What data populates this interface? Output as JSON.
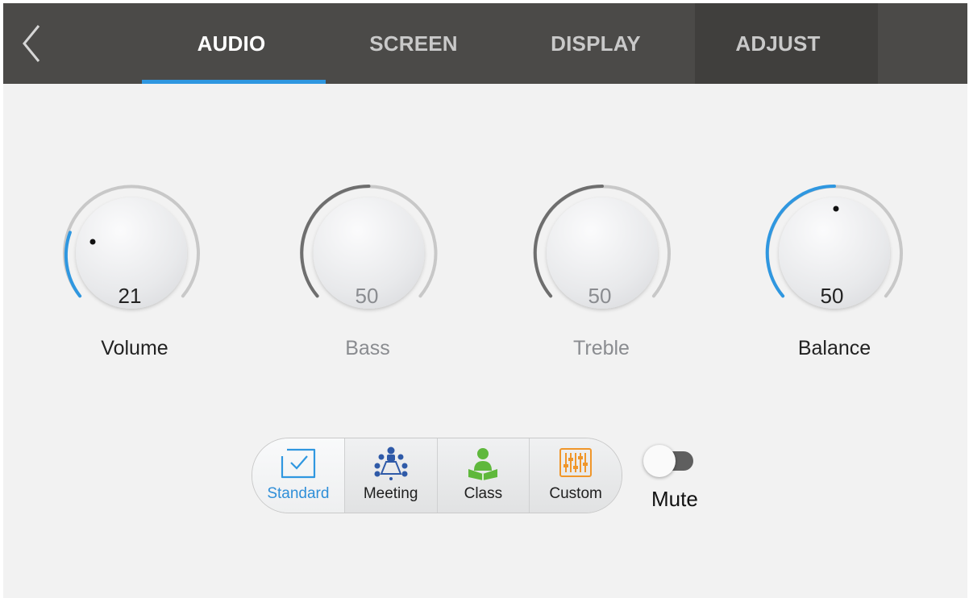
{
  "tabs": [
    {
      "label": "AUDIO",
      "active": true
    },
    {
      "label": "SCREEN",
      "active": false
    },
    {
      "label": "DISPLAY",
      "active": false
    },
    {
      "label": "ADJUST",
      "active": false
    }
  ],
  "knobs": [
    {
      "label": "Volume",
      "value": "21",
      "enabled": true,
      "indicator": true
    },
    {
      "label": "Bass",
      "value": "50",
      "enabled": false,
      "indicator": false
    },
    {
      "label": "Treble",
      "value": "50",
      "enabled": false,
      "indicator": false
    },
    {
      "label": "Balance",
      "value": "50",
      "enabled": true,
      "indicator": true
    }
  ],
  "sound_modes": {
    "selected": "Standard",
    "items": [
      {
        "label": "Standard",
        "icon": "check-box-icon",
        "color": "#2f97e0"
      },
      {
        "label": "Meeting",
        "icon": "meeting-icon",
        "color": "#2f5aa8"
      },
      {
        "label": "Class",
        "icon": "class-icon",
        "color": "#5fb83c"
      },
      {
        "label": "Custom",
        "icon": "equalizer-icon",
        "color": "#f0962a"
      }
    ]
  },
  "mute": {
    "label": "Mute",
    "on": false
  },
  "colors": {
    "accent": "#2f97e0",
    "topbar": "#4b4a48",
    "disabled_text": "#8a8c90"
  }
}
